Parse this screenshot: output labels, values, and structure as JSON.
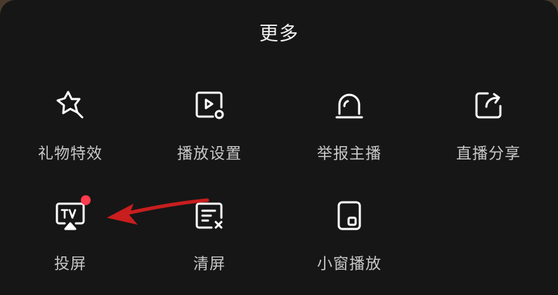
{
  "sheet": {
    "title": "更多"
  },
  "items": [
    {
      "label": "礼物特效",
      "icon": "gift-effect-star-icon"
    },
    {
      "label": "播放设置",
      "icon": "play-settings-icon"
    },
    {
      "label": "举报主播",
      "icon": "report-alarm-icon"
    },
    {
      "label": "直播分享",
      "icon": "share-icon"
    },
    {
      "label": "投屏",
      "icon": "tv-cast-icon"
    },
    {
      "label": "清屏",
      "icon": "clear-screen-icon"
    },
    {
      "label": "小窗播放",
      "icon": "picture-in-picture-icon"
    }
  ],
  "colors": {
    "sheet_background": "#161616",
    "icon_stroke": "#ffffff",
    "label_text": "#c8c8c8",
    "badge": "#ff3b4e",
    "annotation_arrow": "#c81e1e"
  }
}
